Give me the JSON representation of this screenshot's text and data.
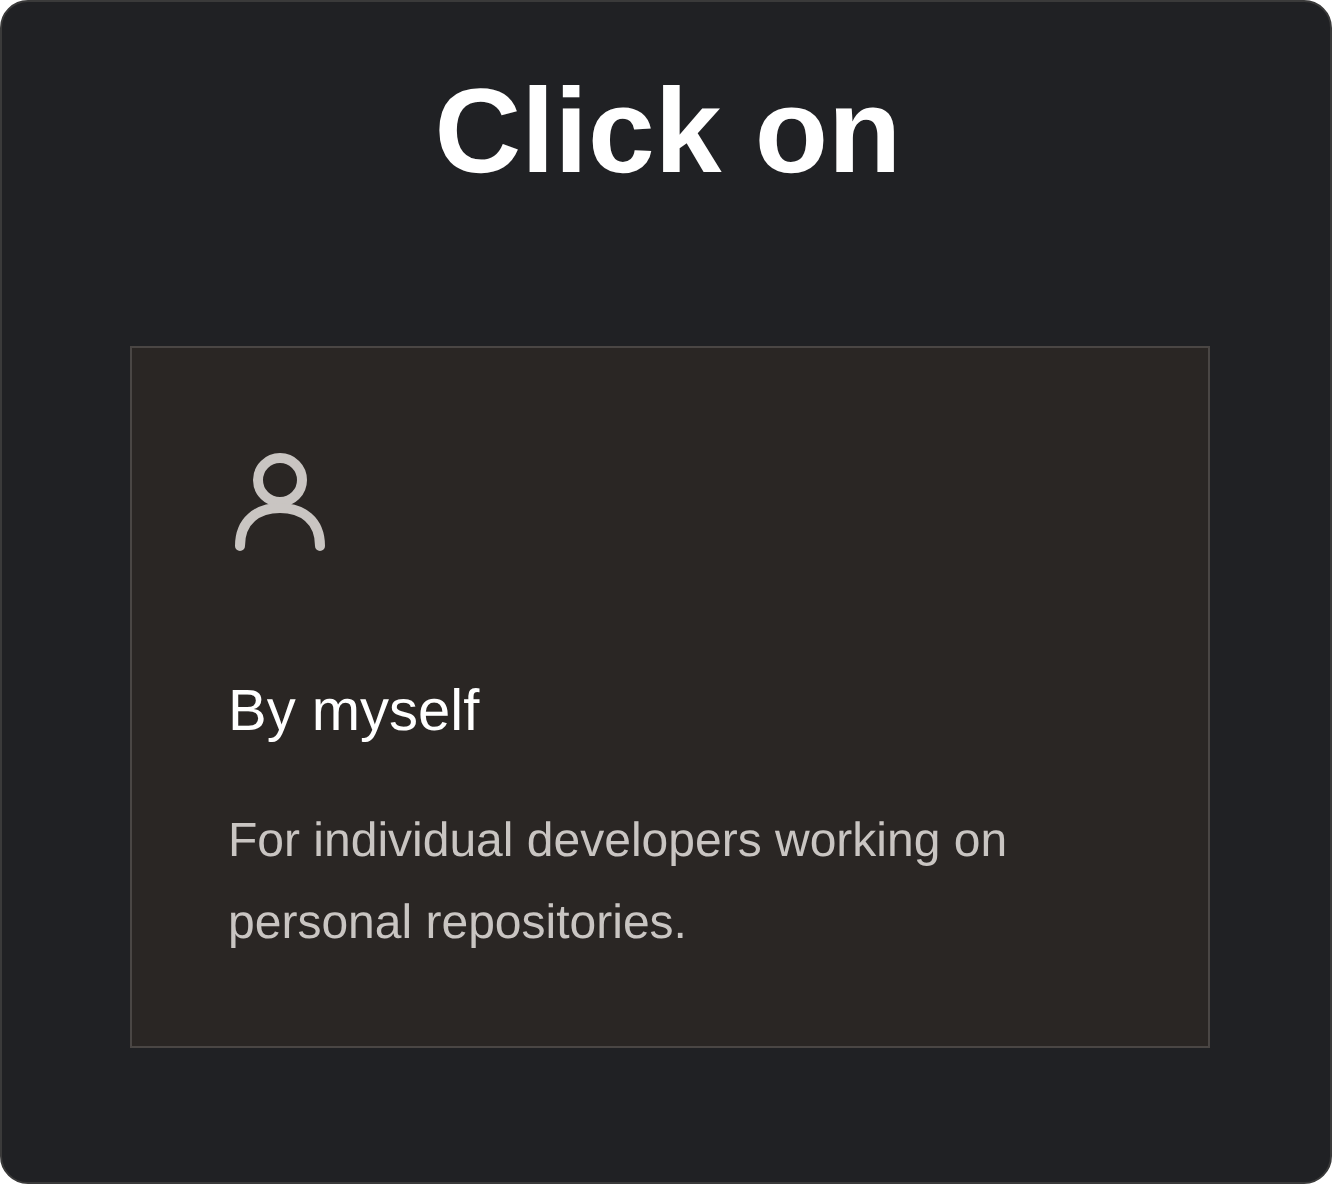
{
  "title": "Click on",
  "card": {
    "heading": "By myself",
    "description": "For individual developers working on personal repositories."
  }
}
